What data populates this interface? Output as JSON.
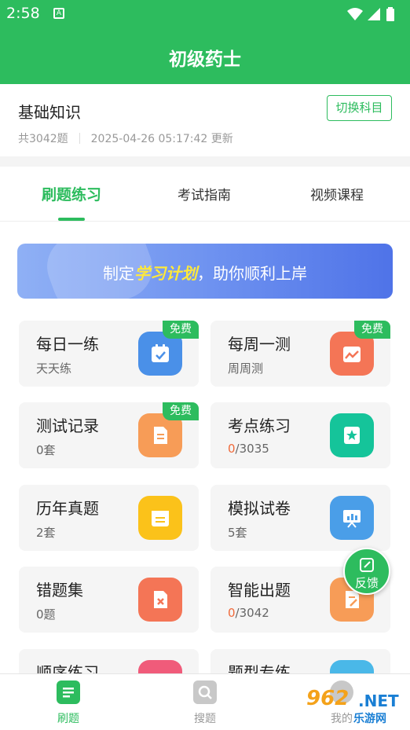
{
  "status_bar": {
    "time": "2:58",
    "notification_icon": "A"
  },
  "header": {
    "title": "初级药士"
  },
  "subject": {
    "name": "基础知识",
    "switch_label": "切换科目",
    "count": "共3042题",
    "updated": "2025-04-26 05:17:42 更新"
  },
  "tabs": [
    {
      "label": "刷题练习",
      "active": true
    },
    {
      "label": "考试指南",
      "active": false
    },
    {
      "label": "视频课程",
      "active": false
    }
  ],
  "banner": {
    "prefix": "制定",
    "highlight": "学习计划",
    "suffix": "，助你顺利上岸"
  },
  "cards": [
    {
      "title": "每日一练",
      "sub": "天天练",
      "badge": "免费",
      "icon": "calendar-check-icon",
      "color": "#4a90e8"
    },
    {
      "title": "每周一测",
      "sub": "周周测",
      "badge": "免费",
      "icon": "chart-calendar-icon",
      "color": "#f47556"
    },
    {
      "title": "测试记录",
      "sub": "0套",
      "badge": "免费",
      "icon": "document-icon",
      "color": "#f79c57"
    },
    {
      "title": "考点练习",
      "sub_done": "0",
      "sub_total": "/3035",
      "icon": "star-book-icon",
      "color": "#15c49a"
    },
    {
      "title": "历年真题",
      "sub": "2套",
      "icon": "calendar-list-icon",
      "color": "#fbc21a"
    },
    {
      "title": "模拟试卷",
      "sub": "5套",
      "icon": "presentation-icon",
      "color": "#4a9ee8"
    },
    {
      "title": "错题集",
      "sub": "0题",
      "icon": "wrong-file-icon",
      "color": "#f47556"
    },
    {
      "title": "智能出题",
      "sub_done": "0",
      "sub_total": "/3042",
      "icon": "edit-doc-icon",
      "color": "#f79c57"
    },
    {
      "title": "顺序练习",
      "icon": "list-icon",
      "color": "#f05b7a"
    },
    {
      "title": "题型专练",
      "icon": "grid-icon",
      "color": "#4ab8e8"
    }
  ],
  "feedback": {
    "label": "反馈"
  },
  "bottom_nav": [
    {
      "label": "刷题",
      "active": true,
      "icon": "notes-icon"
    },
    {
      "label": "搜题",
      "active": false,
      "icon": "search-icon"
    },
    {
      "label": "我的",
      "active": false,
      "icon": "user-icon"
    }
  ],
  "watermark": {
    "number": "962",
    "domain": ".NET",
    "text": "乐游网"
  },
  "colors": {
    "primary": "#2dbc5e",
    "highlight": "#ffe93a",
    "count_highlight": "#f06a3b"
  }
}
